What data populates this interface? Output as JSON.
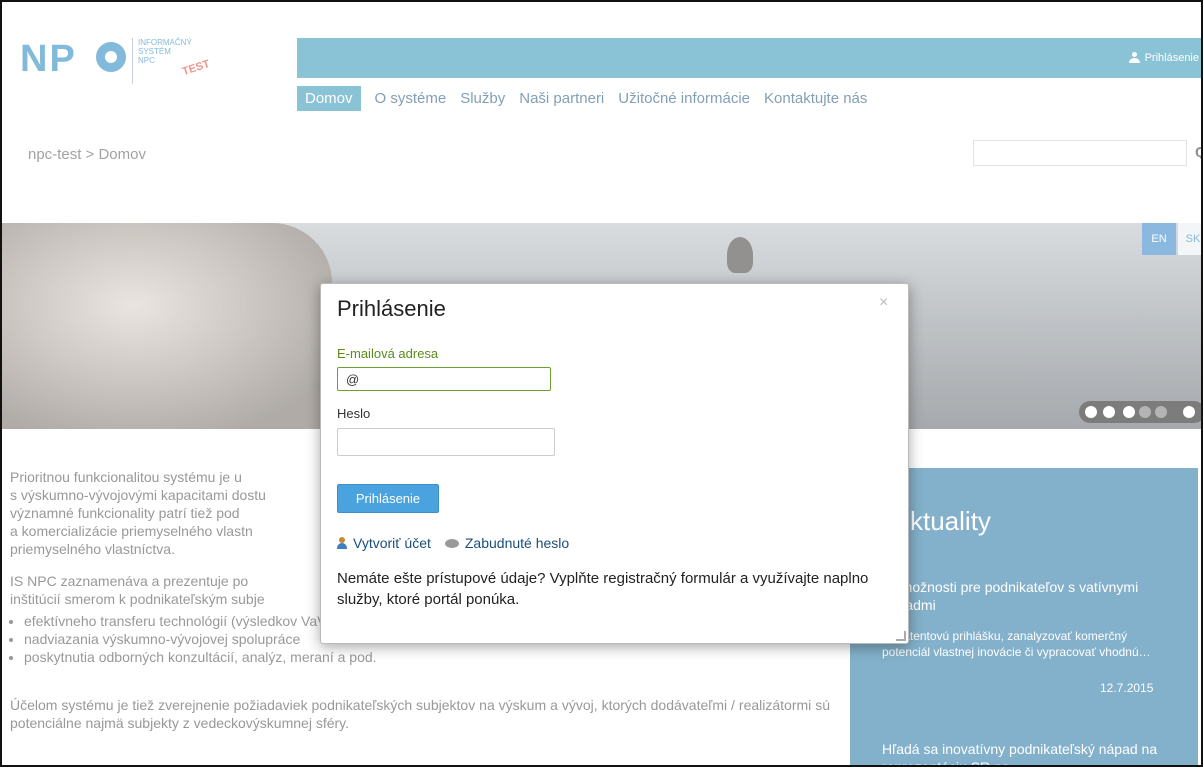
{
  "logo": {
    "text": "NP",
    "sub_line1": "INFORMAČNÝ",
    "sub_line2": "SYSTÉM",
    "sub_line3": "NPC",
    "test_label": "TEST"
  },
  "header": {
    "login_link": "Prihlásenie"
  },
  "nav": {
    "items": [
      {
        "label": "Domov",
        "active": true
      },
      {
        "label": "O systéme"
      },
      {
        "label": "Služby"
      },
      {
        "label": "Naši partneri"
      },
      {
        "label": "Užitočné informácie"
      },
      {
        "label": "Kontaktujte nás"
      }
    ]
  },
  "breadcrumb": "npc-test > Domov",
  "search": {
    "value": "",
    "icon": "search-icon"
  },
  "language": {
    "en": "EN",
    "sk": "SK"
  },
  "slider": {
    "dots": 4,
    "active_index": 0
  },
  "body": {
    "p1": "Prioritnou funkcionalitou systému je u... s výskumno-vývojovými kapacitami dostu... významné funkcionality patrí tiež pod... a komercializácie priemyselného vlastn... priemyselného vlastníctva.",
    "p1_line1": "Prioritnou funkcionalitou systému je u",
    "p1_line2": "s výskumno-vývojovými kapacitami dostu",
    "p1_line3": "významné funkcionality patrí tiež pod",
    "p1_line4": "a komercializácie priemyselného vlastn",
    "p1_line5": "priemyselného vlastníctva.",
    "p2_line1": "IS NPC zaznamenáva a prezentuje po",
    "p2_line2": "inštitúcií smerom k podnikateľským subje",
    "bullets": [
      "efektívneho transferu technológií (výsledkov VaV činnosti) do praxe",
      "nadviazania výskumno-vývojovej spolupráce",
      "poskytnutia odborných konzultácií, analýz, meraní a pod."
    ],
    "p3": "Účelom systému je tiež zverejnenie požiadaviek podnikateľských subjektov na výskum a vývoj, ktorých dodávateľmi / realizátormi sú potenciálne najmä subjekty z vedeckovýskumnej sféry."
  },
  "news": {
    "heading": "ktuality",
    "item1_title": "vé možnosti pre podnikateľov s vatívnymi nápadmi",
    "item1_desc": "ať patentovú prihlášku, zanalyzovať komerčný potenciál vlastnej inovácie či vypracovať vhodnú…",
    "item1_date": "12.7.2015",
    "item2_title": "Hľadá sa inovatívny podnikateľský nápad na reprezentáciu SR na"
  },
  "modal": {
    "title": "Prihlásenie",
    "close": "×",
    "email_label": "E-mailová adresa",
    "email_value": "@",
    "password_label": "Heslo",
    "password_value": "",
    "submit": "Prihlásenie",
    "create_account": "Vytvoriť účet",
    "forgot_password": "Zabudnuté heslo",
    "info": "Nemáte ešte prístupové údaje? Vyplňte registračný formulár a využívajte naplno služby, ktoré portál ponúka."
  }
}
